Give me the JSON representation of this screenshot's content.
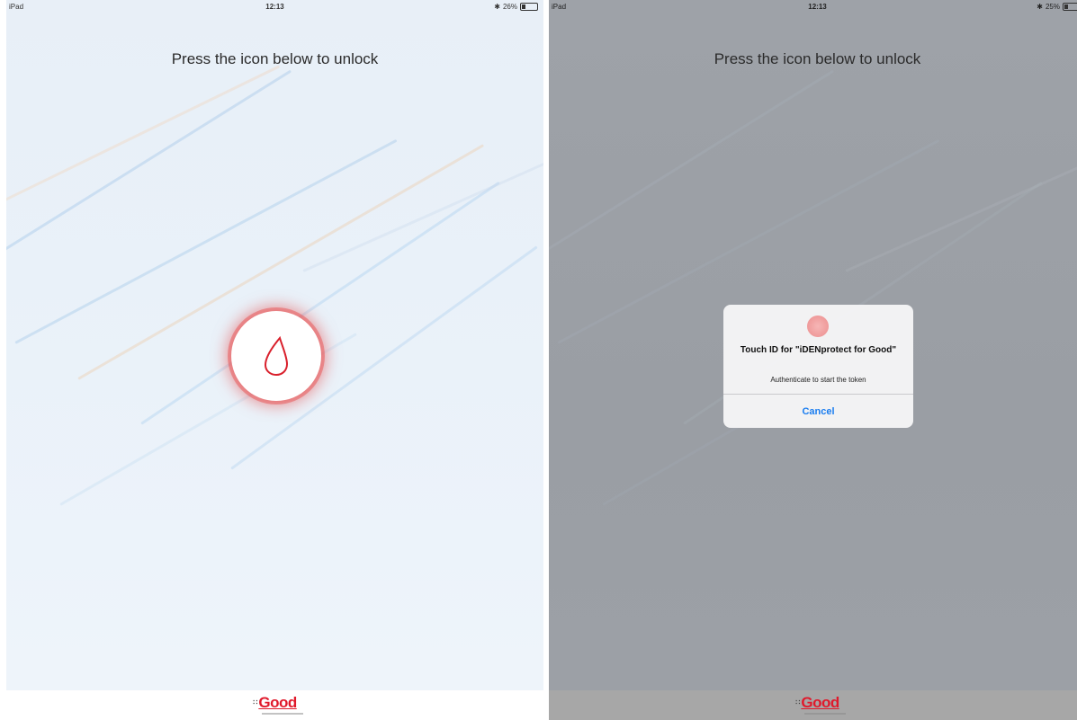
{
  "left_screen": {
    "status": {
      "device": "iPad",
      "time": "12:13",
      "battery": "26%",
      "battery_level": 0.26
    },
    "prompt": "Press the icon below to unlock",
    "fingerprint_icon": "touch-id-droplet-icon",
    "footer_logo": "Good"
  },
  "right_screen": {
    "status": {
      "device": "iPad",
      "time": "12:13",
      "battery": "25%",
      "battery_level": 0.25
    },
    "prompt": "Press the icon below to unlock",
    "footer_logo": "Good",
    "alert": {
      "icon": "touch-id-fingerprint-icon",
      "title": "Touch ID for \"iDENprotect for Good\"",
      "message": "Authenticate to start the token",
      "cancel_label": "Cancel"
    }
  },
  "colors": {
    "accent_red": "#e0192b",
    "ios_blue": "#1a7df0",
    "dim_overlay": "#9a9ea3"
  }
}
